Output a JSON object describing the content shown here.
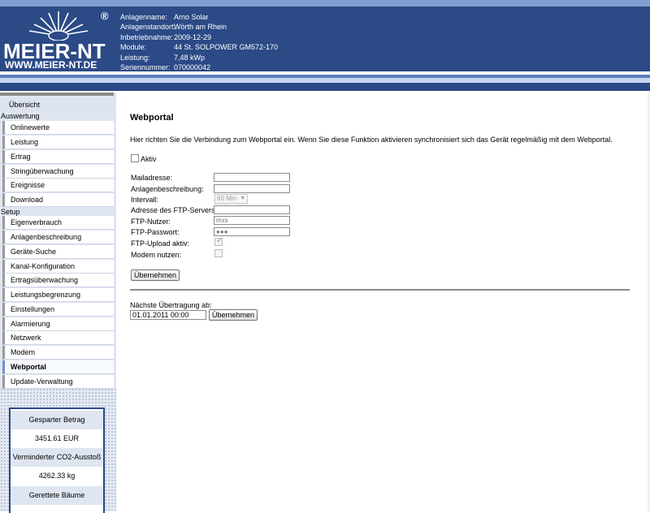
{
  "brand": {
    "name": "MEIER-NT",
    "url": "WWW.MEIER-NT.DE",
    "reg": "®"
  },
  "colors": {
    "header": "#2b4a86",
    "sidebar": "#dfe6f2",
    "active_accent": "#6f8fd0"
  },
  "plant_info": [
    {
      "label": "Anlagenname:",
      "value": "Arno Solar"
    },
    {
      "label": "Anlagenstandort:",
      "value": "Wörth am Rhein"
    },
    {
      "label": "Inbetriebnahme:",
      "value": "2009-12-29"
    },
    {
      "label": "Module:",
      "value": "44 St. SOLPOWER GM572-170"
    },
    {
      "label": "Leistung:",
      "value": "7,48 kWp"
    },
    {
      "label": "Seriennummer:",
      "value": "070000042"
    }
  ],
  "sidebar": {
    "overview": "Übersicht",
    "section_auswertung": "Auswertung",
    "auswertung_items": [
      "Onlinewerte",
      "Leistung",
      "Ertrag",
      "Stringüberwachung",
      "Ereignisse",
      "Download"
    ],
    "section_setup": "Setup",
    "setup_items": [
      "Eigenverbrauch",
      "Anlagenbeschreibung",
      "Geräte-Suche",
      "Kanal-Konfiguration",
      "Ertragsüberwachung",
      "Leistungsbegrenzung",
      "Einstellungen",
      "Alarmierung",
      "Netzwerk",
      "Modem",
      "Webportal",
      "Update-Verwaltung"
    ],
    "active_item": "Webportal"
  },
  "stats": [
    {
      "text": "Gesparter Betrag"
    },
    {
      "text": "3451.61 EUR"
    },
    {
      "text": "Verminderter CO2-Ausstoß"
    },
    {
      "text": "4262.33 kg"
    },
    {
      "text": "Gerettete Bäume"
    }
  ],
  "main": {
    "title": "Webportal",
    "intro": "Hier richten Sie die Verbindung zum Webportal ein. Wenn Sie diese Funktion aktivieren synchronisiert sich das Gerät regelmäßig mit dem Webportal.",
    "aktiv_label": "Aktiv",
    "fields": {
      "mail_label": "Mailadresse:",
      "mail_value": "",
      "desc_label": "Anlagenbeschreibung:",
      "desc_value": "",
      "interval_label": "Intervall:",
      "interval_value": "60 Min",
      "ftp_server_label": "Adresse des FTP-Servers:",
      "ftp_server_value": "",
      "ftp_user_label": "FTP-Nutzer:",
      "ftp_user_value": "mxs",
      "ftp_pass_label": "FTP-Passwort:",
      "ftp_pass_value": "●●●",
      "ftp_upload_label": "FTP-Upload aktiv:",
      "modem_label": "Modem nutzen:"
    },
    "apply_label": "Übernehmen",
    "next_transfer_label": "Nächste Übertragung ab:",
    "next_transfer_value": "01.01.2011 00:00",
    "apply2_label": "Übernehmen"
  }
}
